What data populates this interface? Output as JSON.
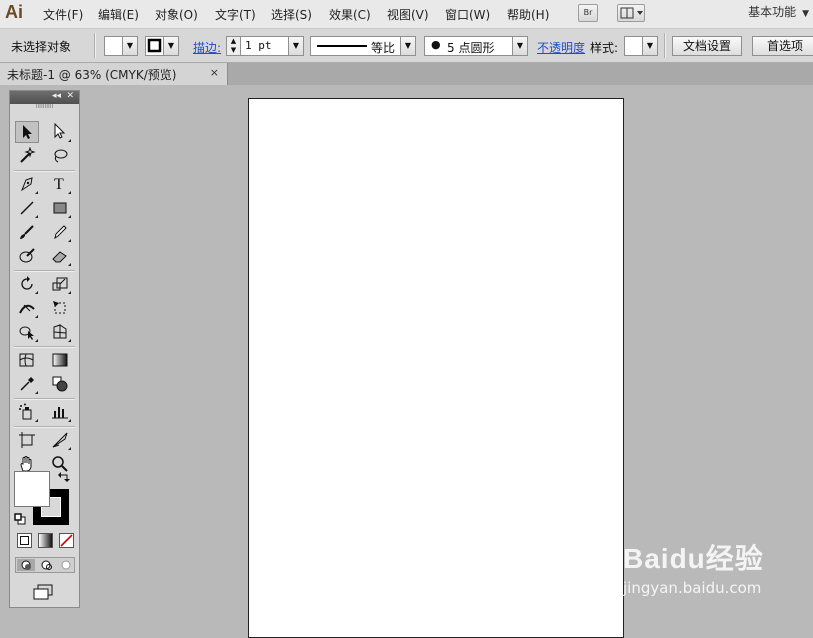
{
  "app": {
    "logo": "Ai"
  },
  "menubar": {
    "items": [
      "文件(F)",
      "编辑(E)",
      "对象(O)",
      "文字(T)",
      "选择(S)",
      "效果(C)",
      "视图(V)",
      "窗口(W)",
      "帮助(H)"
    ],
    "bridge_label": "Br",
    "workspace": "基本功能"
  },
  "controlbar": {
    "selection_status": "未选择对象",
    "stroke_label": "描边:",
    "stroke_weight": "1 pt",
    "stroke_profile": "等比",
    "brush": "5 点圆形",
    "opacity_label": "不透明度",
    "style_label": "样式:",
    "doc_setup": "文档设置",
    "preferences": "首选项"
  },
  "document": {
    "tab_title": "未标题-1 @ 63% (CMYK/预览)",
    "close_glyph": "×"
  },
  "toolbox": {
    "collapse_glyph": "◂◂",
    "close_glyph": "✕",
    "grip": "IIIIIIIIII"
  },
  "watermark": {
    "brand": "Baidu经验",
    "url": "jingyan.baidu.com"
  }
}
